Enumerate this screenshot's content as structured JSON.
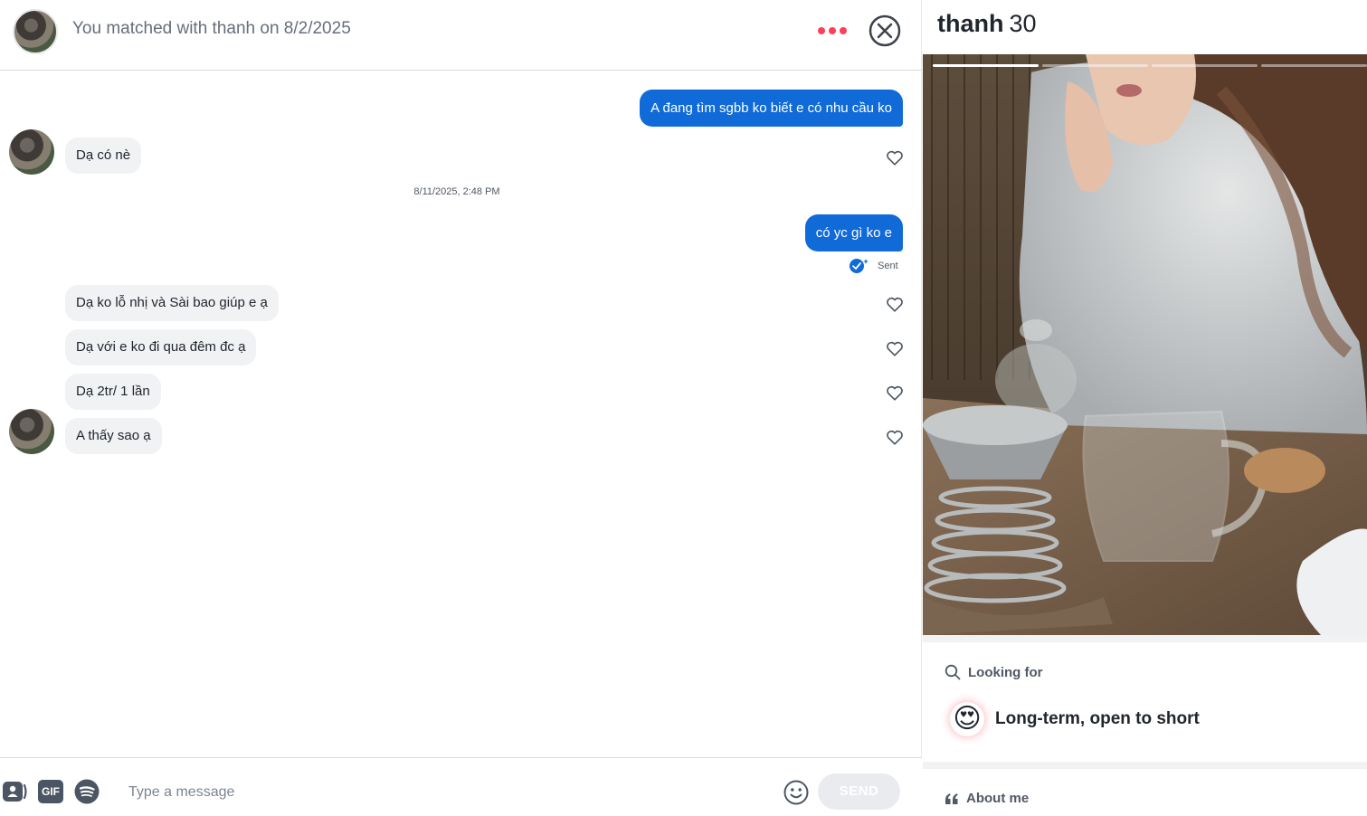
{
  "header": {
    "match_text": "You matched with thanh on 8/2/2025"
  },
  "messages": {
    "out_1": "A đang tìm sgbb ko biết e có nhu cầu ko",
    "in_1": "Dạ có nè",
    "timestamp": "8/11/2025, 2:48 PM",
    "out_2": "có yc gì ko e",
    "sent_status": "Sent",
    "in_2": "Dạ ko lỗ nhị và Sài bao giúp e ạ",
    "in_3": "Dạ với e ko đi qua đêm đc ạ",
    "in_4": "Dạ 2tr/ 1 lần",
    "in_5": "A thấy sao ạ"
  },
  "composer": {
    "gif_label": "GIF",
    "placeholder": "Type a message",
    "send_label": "SEND"
  },
  "profile": {
    "name": "thanh",
    "age": "30",
    "looking_for_label": "Looking for",
    "looking_for_value": "Long-term, open to short",
    "looking_for_emoji": "😍",
    "about_label": "About me"
  },
  "colors": {
    "accent_pink": "#fd3f5a",
    "bubble_out": "#106bd9",
    "bubble_in": "#f0f2f4"
  },
  "icons": [
    "more-icon",
    "close-icon",
    "heart-icon",
    "sent-check-icon",
    "contact-card-icon",
    "spotify-icon",
    "emoji-icon",
    "search-icon",
    "quote-icon"
  ]
}
